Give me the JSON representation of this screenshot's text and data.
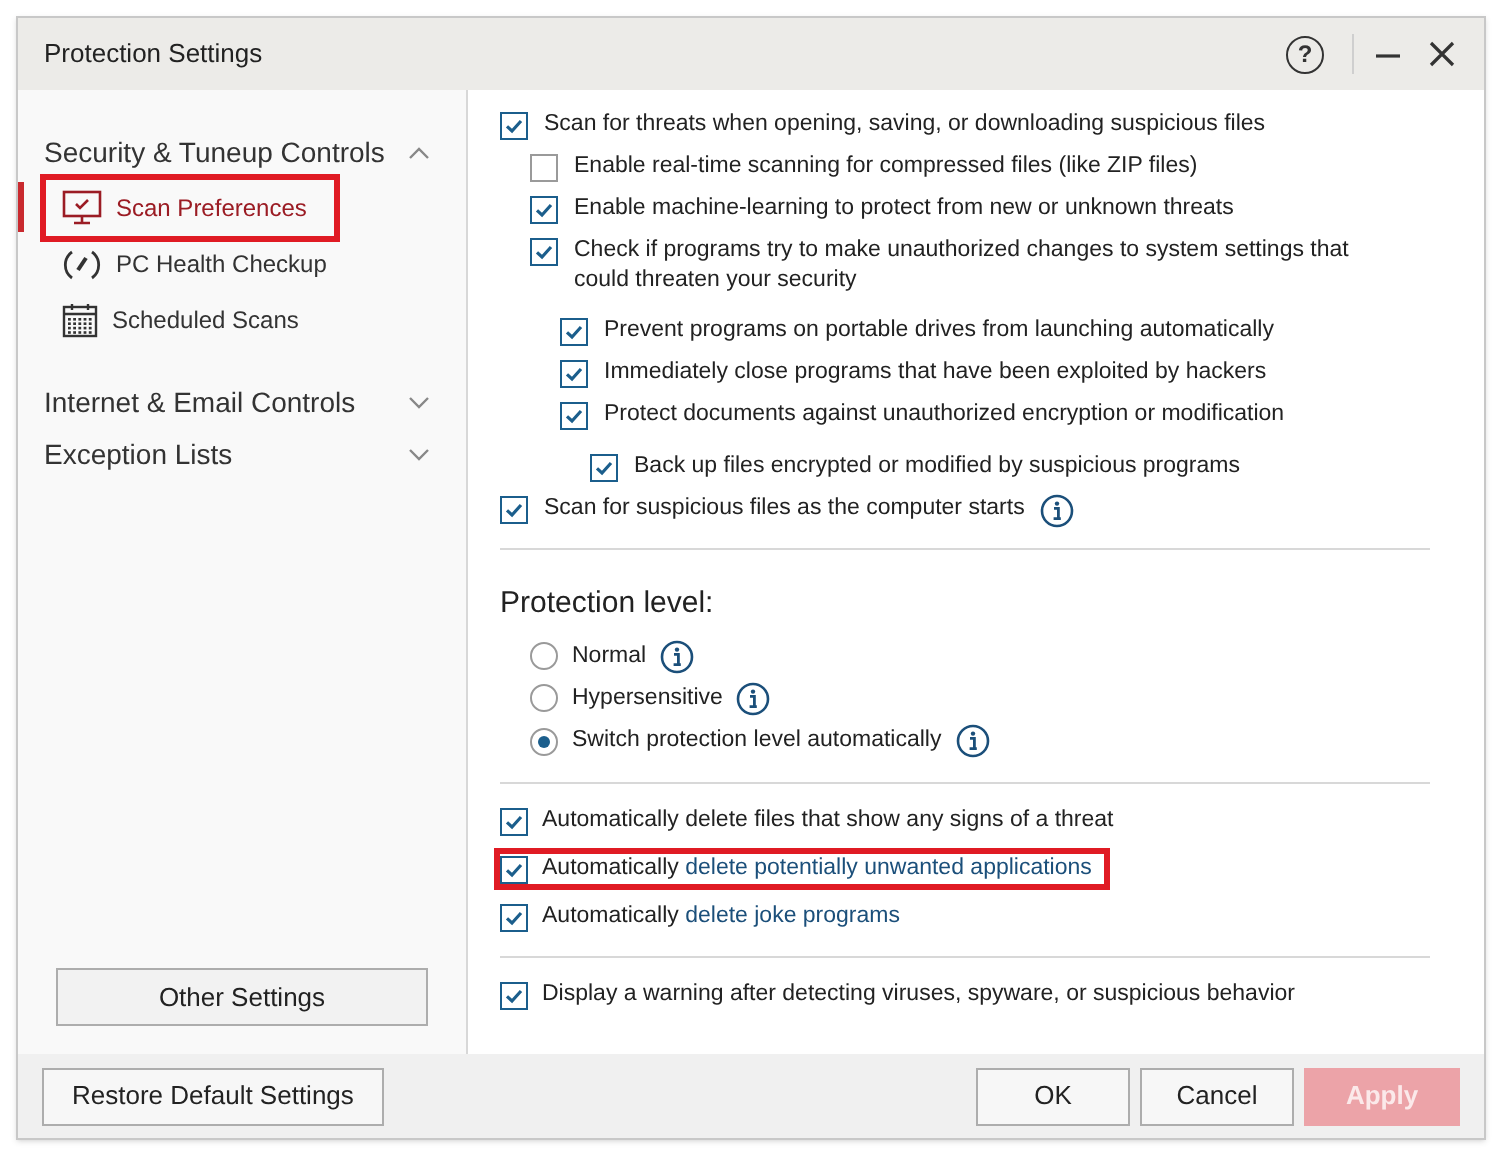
{
  "window": {
    "title": "Protection Settings",
    "help": "?"
  },
  "sidebar": {
    "groups": [
      {
        "label": "Security & Tuneup Controls",
        "expanded": true,
        "items": [
          {
            "label": "Scan Preferences",
            "selected": true,
            "highlighted": true
          },
          {
            "label": "PC Health Checkup",
            "selected": false,
            "highlighted": false
          },
          {
            "label": "Scheduled Scans",
            "selected": false,
            "highlighted": false
          }
        ]
      },
      {
        "label": "Internet & Email Controls",
        "expanded": false
      },
      {
        "label": "Exception Lists",
        "expanded": false
      }
    ],
    "button": "Other Settings"
  },
  "scan_options": [
    {
      "label": "Scan for threats when opening, saving, or downloading suspicious files",
      "checked": true,
      "info": false,
      "children": [
        {
          "label": "Enable real-time scanning for compressed files (like ZIP files)",
          "checked": false,
          "info": false
        },
        {
          "label": "Enable machine-learning to protect from new or unknown threats",
          "checked": true,
          "info": false
        },
        {
          "label": "Check if programs try to make unauthorized changes to system settings that could threaten your security",
          "checked": true,
          "info": false,
          "children": [
            {
              "label": "Prevent programs on portable drives from launching automatically",
              "checked": true,
              "info": false
            },
            {
              "label": "Immediately close programs that have been exploited by hackers",
              "checked": true,
              "info": false
            },
            {
              "label": "Protect documents against unauthorized encryption or modification",
              "checked": true,
              "info": false,
              "children": [
                {
                  "label": "Back up files encrypted or modified by suspicious programs",
                  "checked": true,
                  "info": false
                }
              ]
            }
          ]
        }
      ]
    },
    {
      "label": "Scan for suspicious files as the computer starts",
      "checked": true,
      "info": true
    }
  ],
  "protection_level": {
    "title": "Protection level:",
    "options": [
      {
        "label": "Normal",
        "selected": false
      },
      {
        "label": "Hypersensitive",
        "selected": false
      },
      {
        "label": "Switch protection level automatically",
        "selected": true
      }
    ]
  },
  "delete_options": [
    {
      "label": "Automatically delete files that show any signs of a threat",
      "checked": true,
      "highlighted": false
    },
    {
      "label": "Automatically",
      "link": "delete potentially unwanted applications",
      "checked": true,
      "highlighted": true
    },
    {
      "label": "Automatically",
      "link": "delete joke programs",
      "checked": true,
      "highlighted": false
    }
  ],
  "warning_option": {
    "label": "Display a warning after detecting viruses, spyware, or suspicious behavior",
    "checked": true
  },
  "footer": {
    "restore": "Restore Default Settings",
    "ok": "OK",
    "cancel": "Cancel",
    "apply": "Apply",
    "apply_disabled": true
  }
}
